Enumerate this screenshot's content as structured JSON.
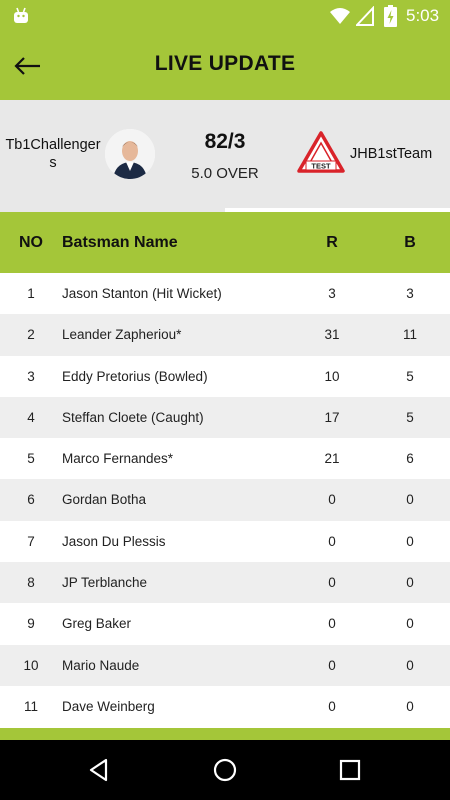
{
  "status_bar": {
    "time": "5:03",
    "icons": [
      "android-icon",
      "wifi-icon",
      "signal-icon",
      "battery-charging-icon"
    ]
  },
  "toolbar": {
    "title": "LIVE UPDATE",
    "back_icon": "arrow-left-icon"
  },
  "match": {
    "team1": "Tb1Challengers",
    "team2": "JHB1stTeam",
    "team2_logo_text": "TEST",
    "score": "82/3",
    "overs": "5.0 OVER"
  },
  "colors": {
    "accent": "#a4c639",
    "card_bg": "#e8e8e8",
    "row_alt": "#eeeeee",
    "logo_red": "#d9232a"
  },
  "table": {
    "headers": {
      "no": "NO",
      "name": "Batsman Name",
      "runs": "R",
      "balls": "B"
    },
    "rows": [
      {
        "no": "1",
        "name": "Jason Stanton (Hit Wicket)",
        "r": "3",
        "b": "3"
      },
      {
        "no": "2",
        "name": "Leander Zapheriou*",
        "r": "31",
        "b": "11"
      },
      {
        "no": "3",
        "name": "Eddy Pretorius (Bowled)",
        "r": "10",
        "b": "5"
      },
      {
        "no": "4",
        "name": "Steffan Cloete (Caught)",
        "r": "17",
        "b": "5"
      },
      {
        "no": "5",
        "name": "Marco Fernandes*",
        "r": "21",
        "b": "6"
      },
      {
        "no": "6",
        "name": "Gordan Botha",
        "r": "0",
        "b": "0"
      },
      {
        "no": "7",
        "name": "Jason Du Plessis",
        "r": "0",
        "b": "0"
      },
      {
        "no": "8",
        "name": "JP Terblanche",
        "r": "0",
        "b": "0"
      },
      {
        "no": "9",
        "name": "Greg Baker",
        "r": "0",
        "b": "0"
      },
      {
        "no": "10",
        "name": "Mario Naude",
        "r": "0",
        "b": "0"
      },
      {
        "no": "11",
        "name": "Dave Weinberg",
        "r": "0",
        "b": "0"
      }
    ]
  },
  "nav_bar": {
    "buttons": [
      "back-triangle-icon",
      "home-circle-icon",
      "recents-square-icon"
    ]
  }
}
